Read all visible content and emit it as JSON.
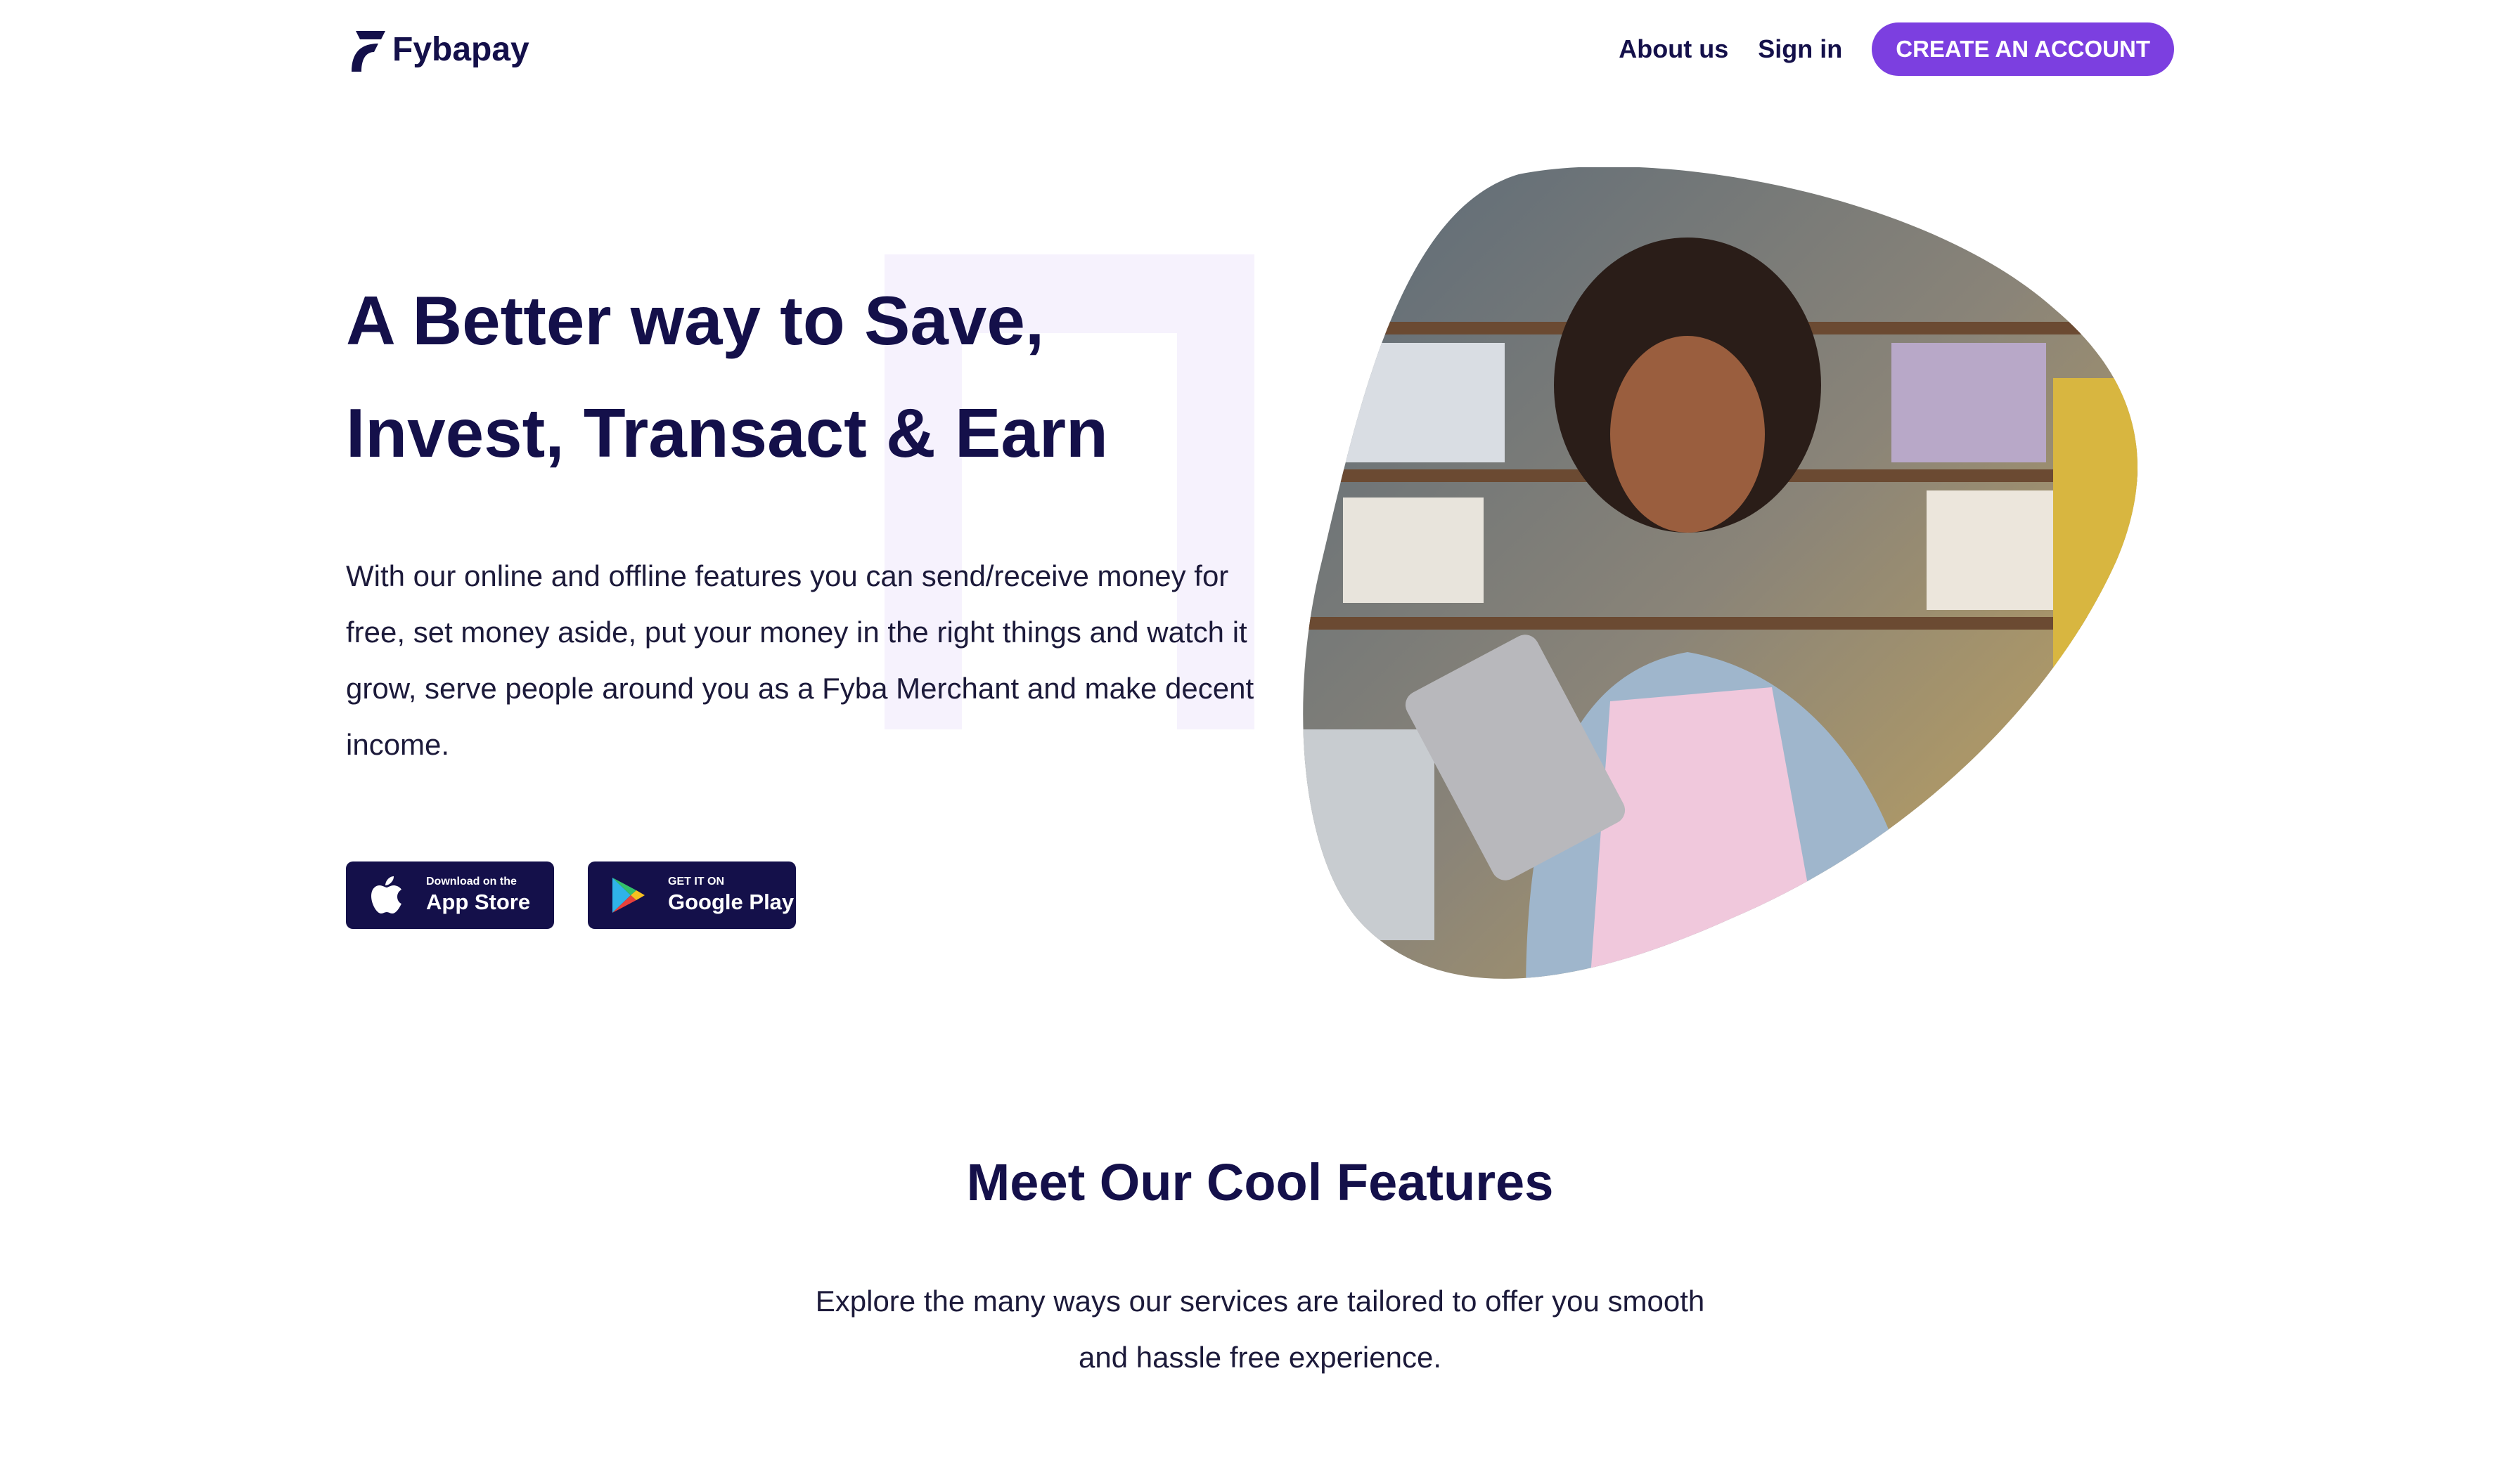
{
  "brand": {
    "name": "Fybapay",
    "accent": "#7c3fe0",
    "dark": "#14104a"
  },
  "nav": {
    "about": "About us",
    "signin": "Sign in",
    "cta": "CREATE AN ACCOUNT"
  },
  "hero": {
    "title_line1": "A Better way to Save,",
    "title_line2": "Invest, Transact & Earn",
    "description": "With our online and offline features you can send/receive money for free, set money aside, put your money in the right things and watch it grow, serve people around you as a Fyba Merchant and make decent income.",
    "image_icon": "woman-with-tablet-photo"
  },
  "stores": {
    "apple": {
      "small": "Download on the",
      "big": "App Store",
      "icon": "apple-icon"
    },
    "google": {
      "small": "GET IT ON",
      "big": "Google Play",
      "icon": "google-play-icon"
    }
  },
  "features": {
    "title": "Meet Our Cool Features",
    "description": "Explore the many ways our services are tailored to offer you smooth and hassle free experience."
  }
}
